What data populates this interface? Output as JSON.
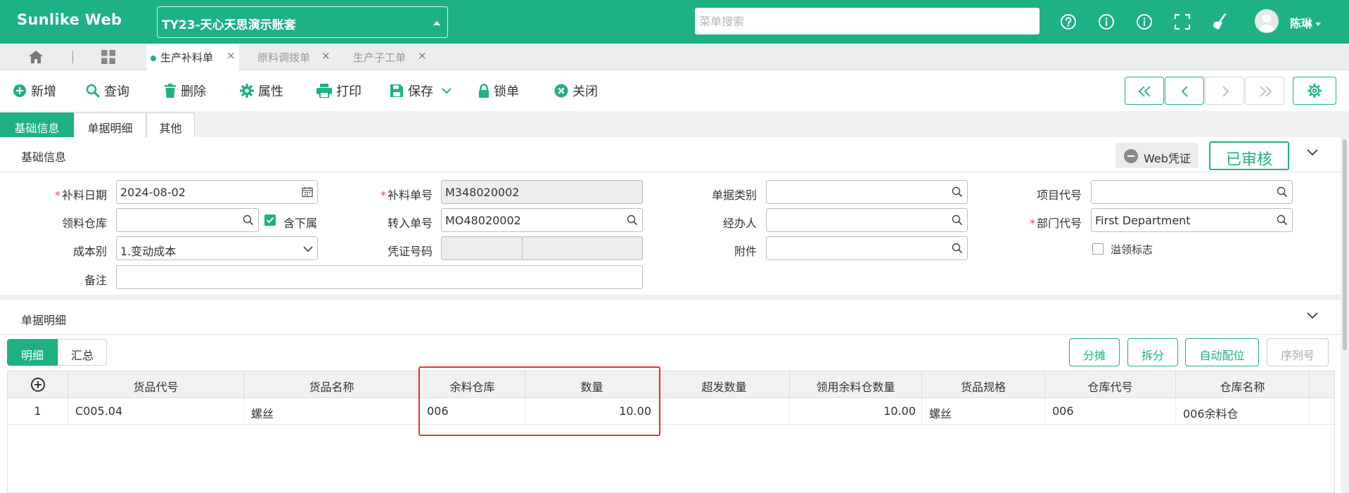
{
  "app": {
    "brand": "Sunlike Web",
    "account": "TY23-天心天思演示账套",
    "menu_search_placeholder": "菜单搜索",
    "user_name": "陈琳",
    "accent_color": "#1db184"
  },
  "tabs": [
    {
      "label": "生产补料单",
      "active": true
    },
    {
      "label": "原料调拨单",
      "active": false
    },
    {
      "label": "生产子工单",
      "active": false
    }
  ],
  "toolbar": {
    "new": "新增",
    "query": "查询",
    "delete": "删除",
    "properties": "属性",
    "print": "打印",
    "save": "保存",
    "lock": "锁单",
    "close": "关闭"
  },
  "section_tabs": [
    "基础信息",
    "单据明细",
    "其他"
  ],
  "basic": {
    "title": "基础信息",
    "web_voucher": "Web凭证",
    "status": "已审核",
    "fields": {
      "supp_date_label": "补料日期",
      "supp_date_value": "2024-08-02",
      "supp_no_label": "补料单号",
      "supp_no_value": "M348020002",
      "doc_type_label": "单据类别",
      "doc_type_value": "",
      "project_label": "项目代号",
      "project_value": "",
      "warehouse_label": "领料仓库",
      "warehouse_value": "",
      "include_sub_label": "含下属",
      "include_sub_checked": true,
      "transfer_no_label": "转入单号",
      "transfer_no_value": "MO48020002",
      "handler_label": "经办人",
      "handler_value": "",
      "dept_label": "部门代号",
      "dept_value": "First Department",
      "cost_label": "成本别",
      "cost_value": "1.变动成本",
      "voucher_label": "凭证号码",
      "voucher_value1": "",
      "voucher_value2": "",
      "attachment_label": "附件",
      "attachment_value": "",
      "overflow_label": "溢领标志",
      "overflow_checked": false,
      "remark_label": "备注",
      "remark_value": ""
    }
  },
  "detail": {
    "title": "单据明细",
    "tabs": [
      "明细",
      "汇总"
    ],
    "buttons": {
      "split_share": "分摊",
      "split": "拆分",
      "auto_alloc": "自动配位",
      "serial": "序列号"
    },
    "columns": [
      "货品代号",
      "货品名称",
      "余料仓库",
      "数量",
      "超发数量",
      "领用余料仓数量",
      "货品规格",
      "仓库代号",
      "仓库名称"
    ],
    "rows": [
      {
        "no": "1",
        "item_code": "C005.04",
        "item_name": "螺丝",
        "surplus_wh": "006",
        "qty": "10.00",
        "over_qty": "",
        "surplus_qty": "10.00",
        "spec": "螺丝",
        "wh_code": "006",
        "wh_name": "006余料仓"
      }
    ]
  }
}
